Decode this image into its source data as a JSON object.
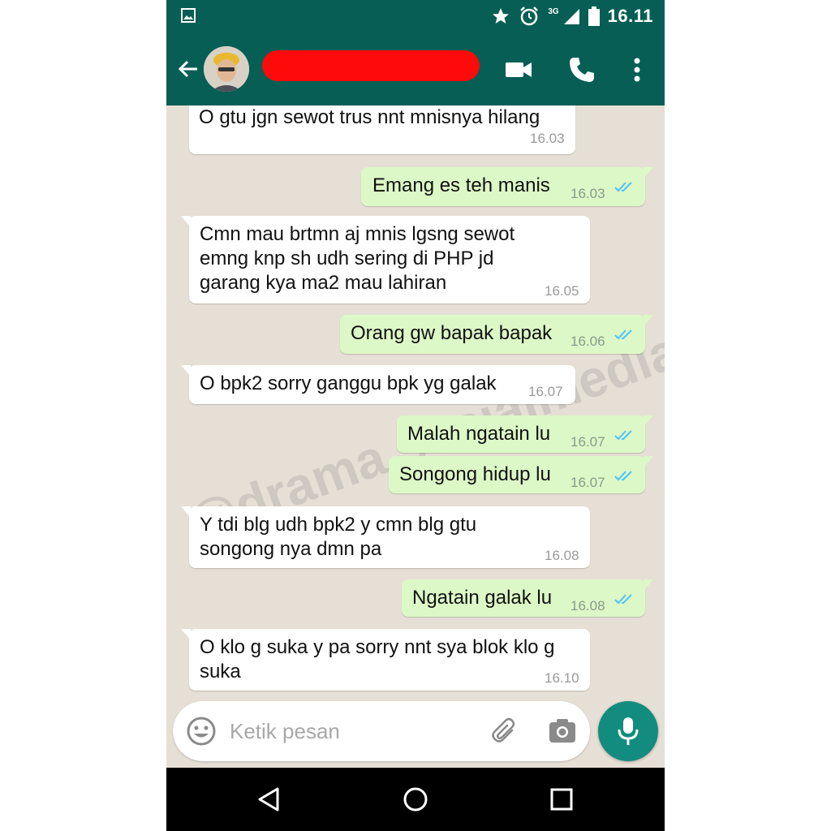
{
  "status_bar": {
    "time": "16.11",
    "network": "3G",
    "icons": [
      "image-icon",
      "star-icon",
      "alarm-icon",
      "signal-icon",
      "battery-icon"
    ]
  },
  "header": {
    "contact_name_redacted": true,
    "actions": [
      "video-call-icon",
      "phone-icon",
      "more-vert-icon"
    ]
  },
  "messages": [
    {
      "dir": "in",
      "lines": "O gtu jgn sewot trus nnt mnisnya hilang",
      "time": "16.03"
    },
    {
      "dir": "out",
      "lines": "Emang es teh manis",
      "time": "16.03"
    },
    {
      "dir": "in",
      "lines": "Cmn mau brtmn aj mnis lgsng sewot\nemng knp sh udh sering di PHP jd\ngarang kya ma2 mau lahiran",
      "time": "16.05"
    },
    {
      "dir": "out",
      "lines": "Orang gw bapak bapak",
      "time": "16.06"
    },
    {
      "dir": "in",
      "lines": "O bpk2 sorry ganggu bpk yg galak",
      "time": "16.07"
    },
    {
      "dir": "out",
      "lines": "Malah ngatain lu",
      "time": "16.07"
    },
    {
      "dir": "out",
      "lines": "Songong hidup lu",
      "time": "16.07"
    },
    {
      "dir": "in",
      "lines": "Y tdi blg udh bpk2 y cmn blg gtu\nsongong nya dmn pa",
      "time": "16.08"
    },
    {
      "dir": "out",
      "lines": "Ngatain galak lu",
      "time": "16.08"
    },
    {
      "dir": "in",
      "lines": "O klo g suka y pa sorry nnt sya blok klo g\nsuka",
      "time": "16.10"
    }
  ],
  "watermark": "@drama.sosialmedia",
  "composer": {
    "placeholder": "Ketik pesan"
  },
  "colors": {
    "header": "#075e54",
    "outgoing_bubble": "#dcf8c6",
    "incoming_bubble": "#ffffff",
    "chat_background": "#e6dfd6",
    "mic_button": "#128c7e",
    "read_ticks": "#4fc3f7"
  }
}
